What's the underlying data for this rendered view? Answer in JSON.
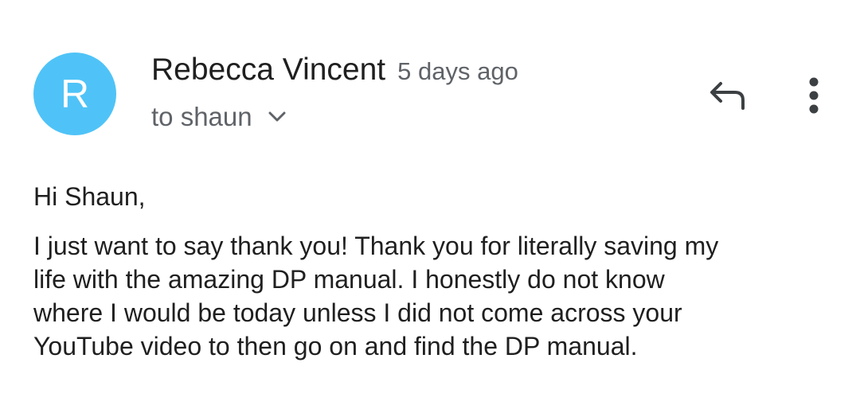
{
  "sender": {
    "initial": "R",
    "name": "Rebecca Vincent",
    "avatar_color": "#4fc3f7"
  },
  "timestamp": "5 days ago",
  "recipient": {
    "text": "to shaun"
  },
  "actions": {
    "reply_icon": "reply-icon",
    "more_icon": "more-vert-icon",
    "chevron_icon": "chevron-down-icon"
  },
  "body": {
    "greeting": "Hi Shaun,",
    "message": "I just want to say thank you! Thank you for literally saving my\nlife with the amazing DP manual.  I honestly do not know\nwhere I would be today unless I did not come across your\nYouTube video to then go on and find the DP manual."
  }
}
